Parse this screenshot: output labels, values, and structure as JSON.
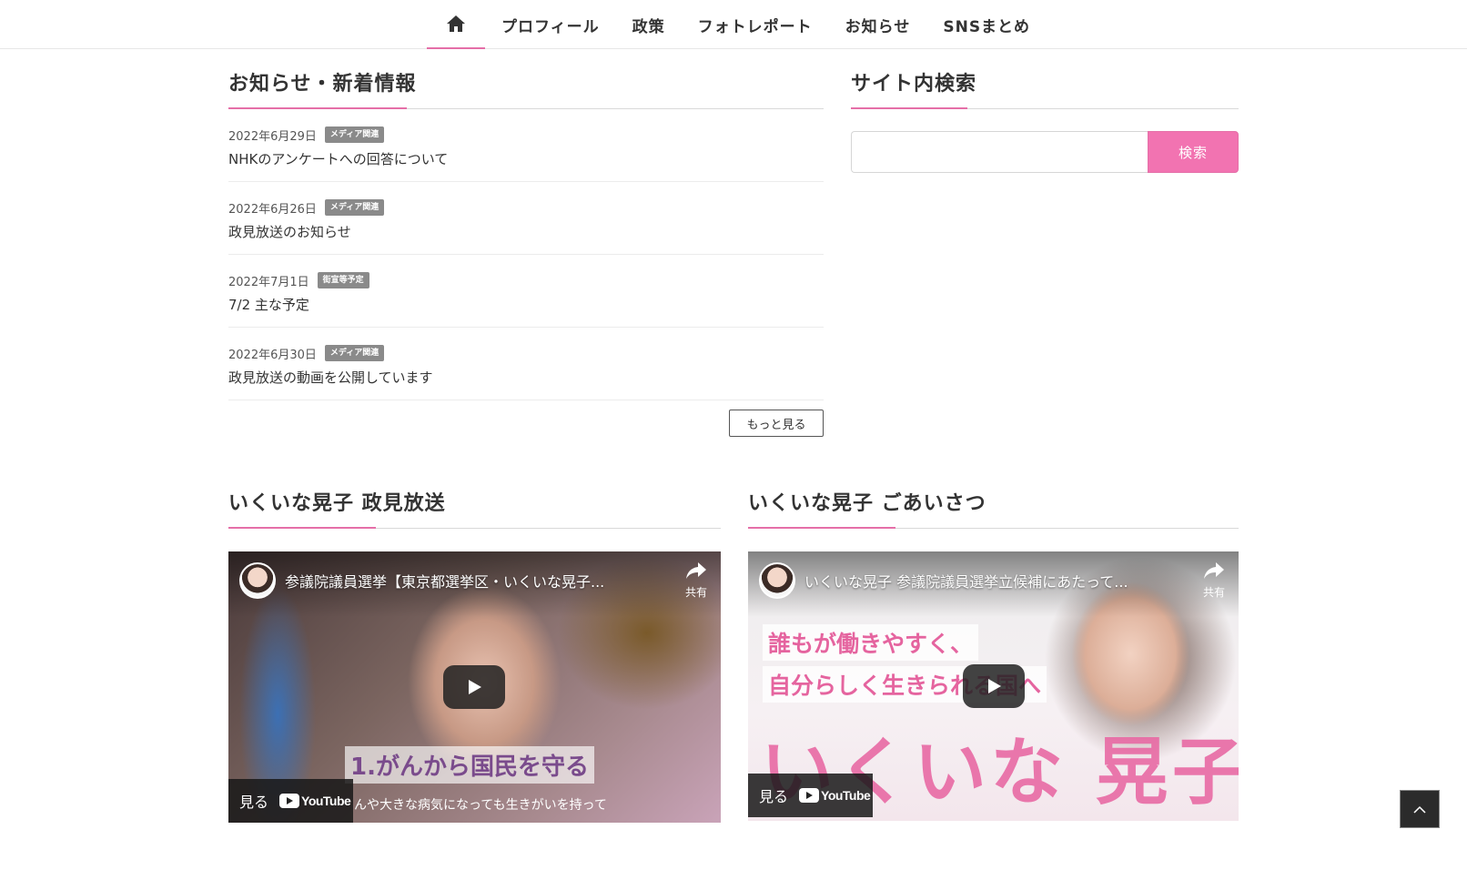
{
  "nav": {
    "home_icon": "home-icon",
    "items": [
      {
        "label": "プロフィール"
      },
      {
        "label": "政策"
      },
      {
        "label": "フォトレポート"
      },
      {
        "label": "お知らせ"
      },
      {
        "label": "SNSまとめ"
      }
    ]
  },
  "news": {
    "heading": "お知らせ・新着情報",
    "items": [
      {
        "date": "2022年6月29日",
        "category": "メディア関連",
        "title": "NHKのアンケートへの回答について"
      },
      {
        "date": "2022年6月26日",
        "category": "メディア関連",
        "title": "政見放送のお知らせ"
      },
      {
        "date": "2022年7月1日",
        "category": "街宣等予定",
        "title": "7/2 主な予定"
      },
      {
        "date": "2022年6月30日",
        "category": "メディア関連",
        "title": "政見放送の動画を公開しています"
      }
    ],
    "more_label": "もっと見る"
  },
  "search": {
    "heading": "サイト内検索",
    "placeholder": "",
    "button_label": "検索"
  },
  "videos": [
    {
      "heading": "いくいな晃子 政見放送",
      "title": "参議院議員選挙【東京都選挙区・いくいな晃子...",
      "share_label": "共有",
      "watch_label": "見る",
      "platform": "YouTube",
      "caption": "1.がんから国民を守る",
      "subcaption": "んや大きな病気になっても生きがいを持って"
    },
    {
      "heading": "いくいな晃子 ごあいさつ",
      "title": "いくいな晃子 参議院議員選挙立候補にあたって...",
      "share_label": "共有",
      "watch_label": "見る",
      "platform": "YouTube",
      "caption_line1": "誰もが働きやすく、",
      "caption_line2": "自分らしく生きられる国へ",
      "big_name": "いくいな 晃子"
    }
  ],
  "colors": {
    "accent": "#e56fa8",
    "search_button": "#f273b1",
    "category_badge": "#8a8a8a"
  }
}
